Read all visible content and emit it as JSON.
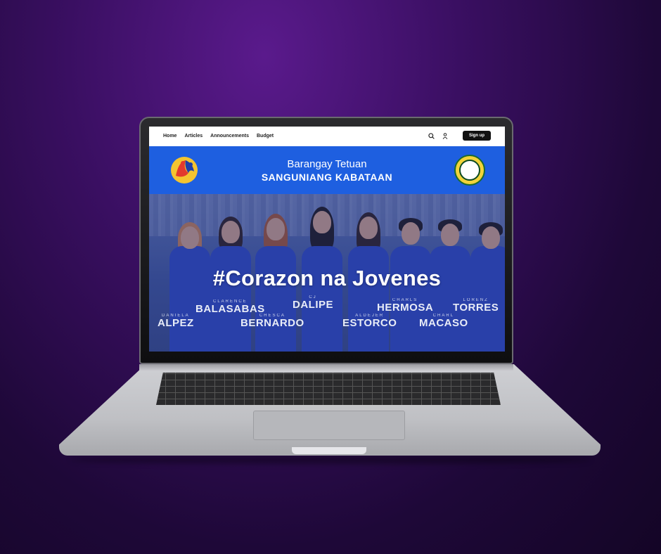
{
  "nav": {
    "links": [
      "Home",
      "Articles",
      "Announcements",
      "Budget"
    ],
    "signup_label": "Sign up"
  },
  "banner": {
    "line1": "Barangay Tetuan",
    "line2": "SANGUNIANG KABATAAN"
  },
  "hero": {
    "title": "#Corazon na Jovenes",
    "names": [
      {
        "first": "DANIELA",
        "last": "ALPEZ"
      },
      {
        "first": "CLARENCE",
        "last": "BALASABAS"
      },
      {
        "first": "CHESCA",
        "last": "BERNARDO"
      },
      {
        "first": "CJ",
        "last": "DALIPE"
      },
      {
        "first": "ALDEJER",
        "last": "ESTORCO"
      },
      {
        "first": "CHARLS",
        "last": "HERMOSA"
      },
      {
        "first": "CHARL",
        "last": "MACASO"
      },
      {
        "first": "LORENZ",
        "last": "TORRES"
      }
    ]
  },
  "colors": {
    "background": "#3a0f62",
    "banner": "#1e5fe0",
    "uniform": "#2a42b8",
    "signup_button": "#111111"
  },
  "icons": {
    "search": "search-icon",
    "user": "user-icon"
  }
}
